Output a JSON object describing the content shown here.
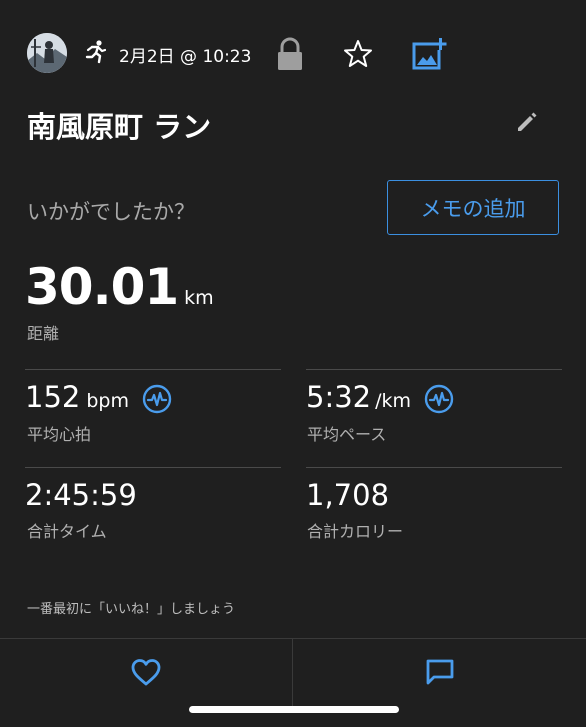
{
  "header": {
    "date_time": "2月2日 @ 10:23",
    "icons": {
      "avatar": "avatar-photo",
      "activity": "running-person-icon",
      "lock": "lock-icon",
      "star": "star-icon",
      "add_photo": "add-photo-icon"
    }
  },
  "activity": {
    "title": "南風原町 ラン",
    "question": "いかがでしたか？",
    "memo_button_label": "メモの追加"
  },
  "distance": {
    "value": "30.01",
    "unit": "km",
    "label": "距離"
  },
  "stats": {
    "heart_rate": {
      "value": "152",
      "unit": "bpm",
      "label": "平均心拍"
    },
    "pace": {
      "value": "5:32",
      "unit": "/km",
      "label": "平均ペース"
    },
    "total_time": {
      "value": "2:45:59",
      "label": "合計タイム"
    },
    "calories": {
      "value": "1,708",
      "label": "合計カロリー"
    }
  },
  "kudos_prompt": "一番最初に「いいね！」しましょう",
  "bottom_bar": {
    "like_icon": "heart-icon",
    "comment_icon": "comment-icon"
  },
  "colors": {
    "background": "#1f1f1f",
    "accent": "#3b8fe0",
    "secondary_text": "#b0b0b0"
  }
}
